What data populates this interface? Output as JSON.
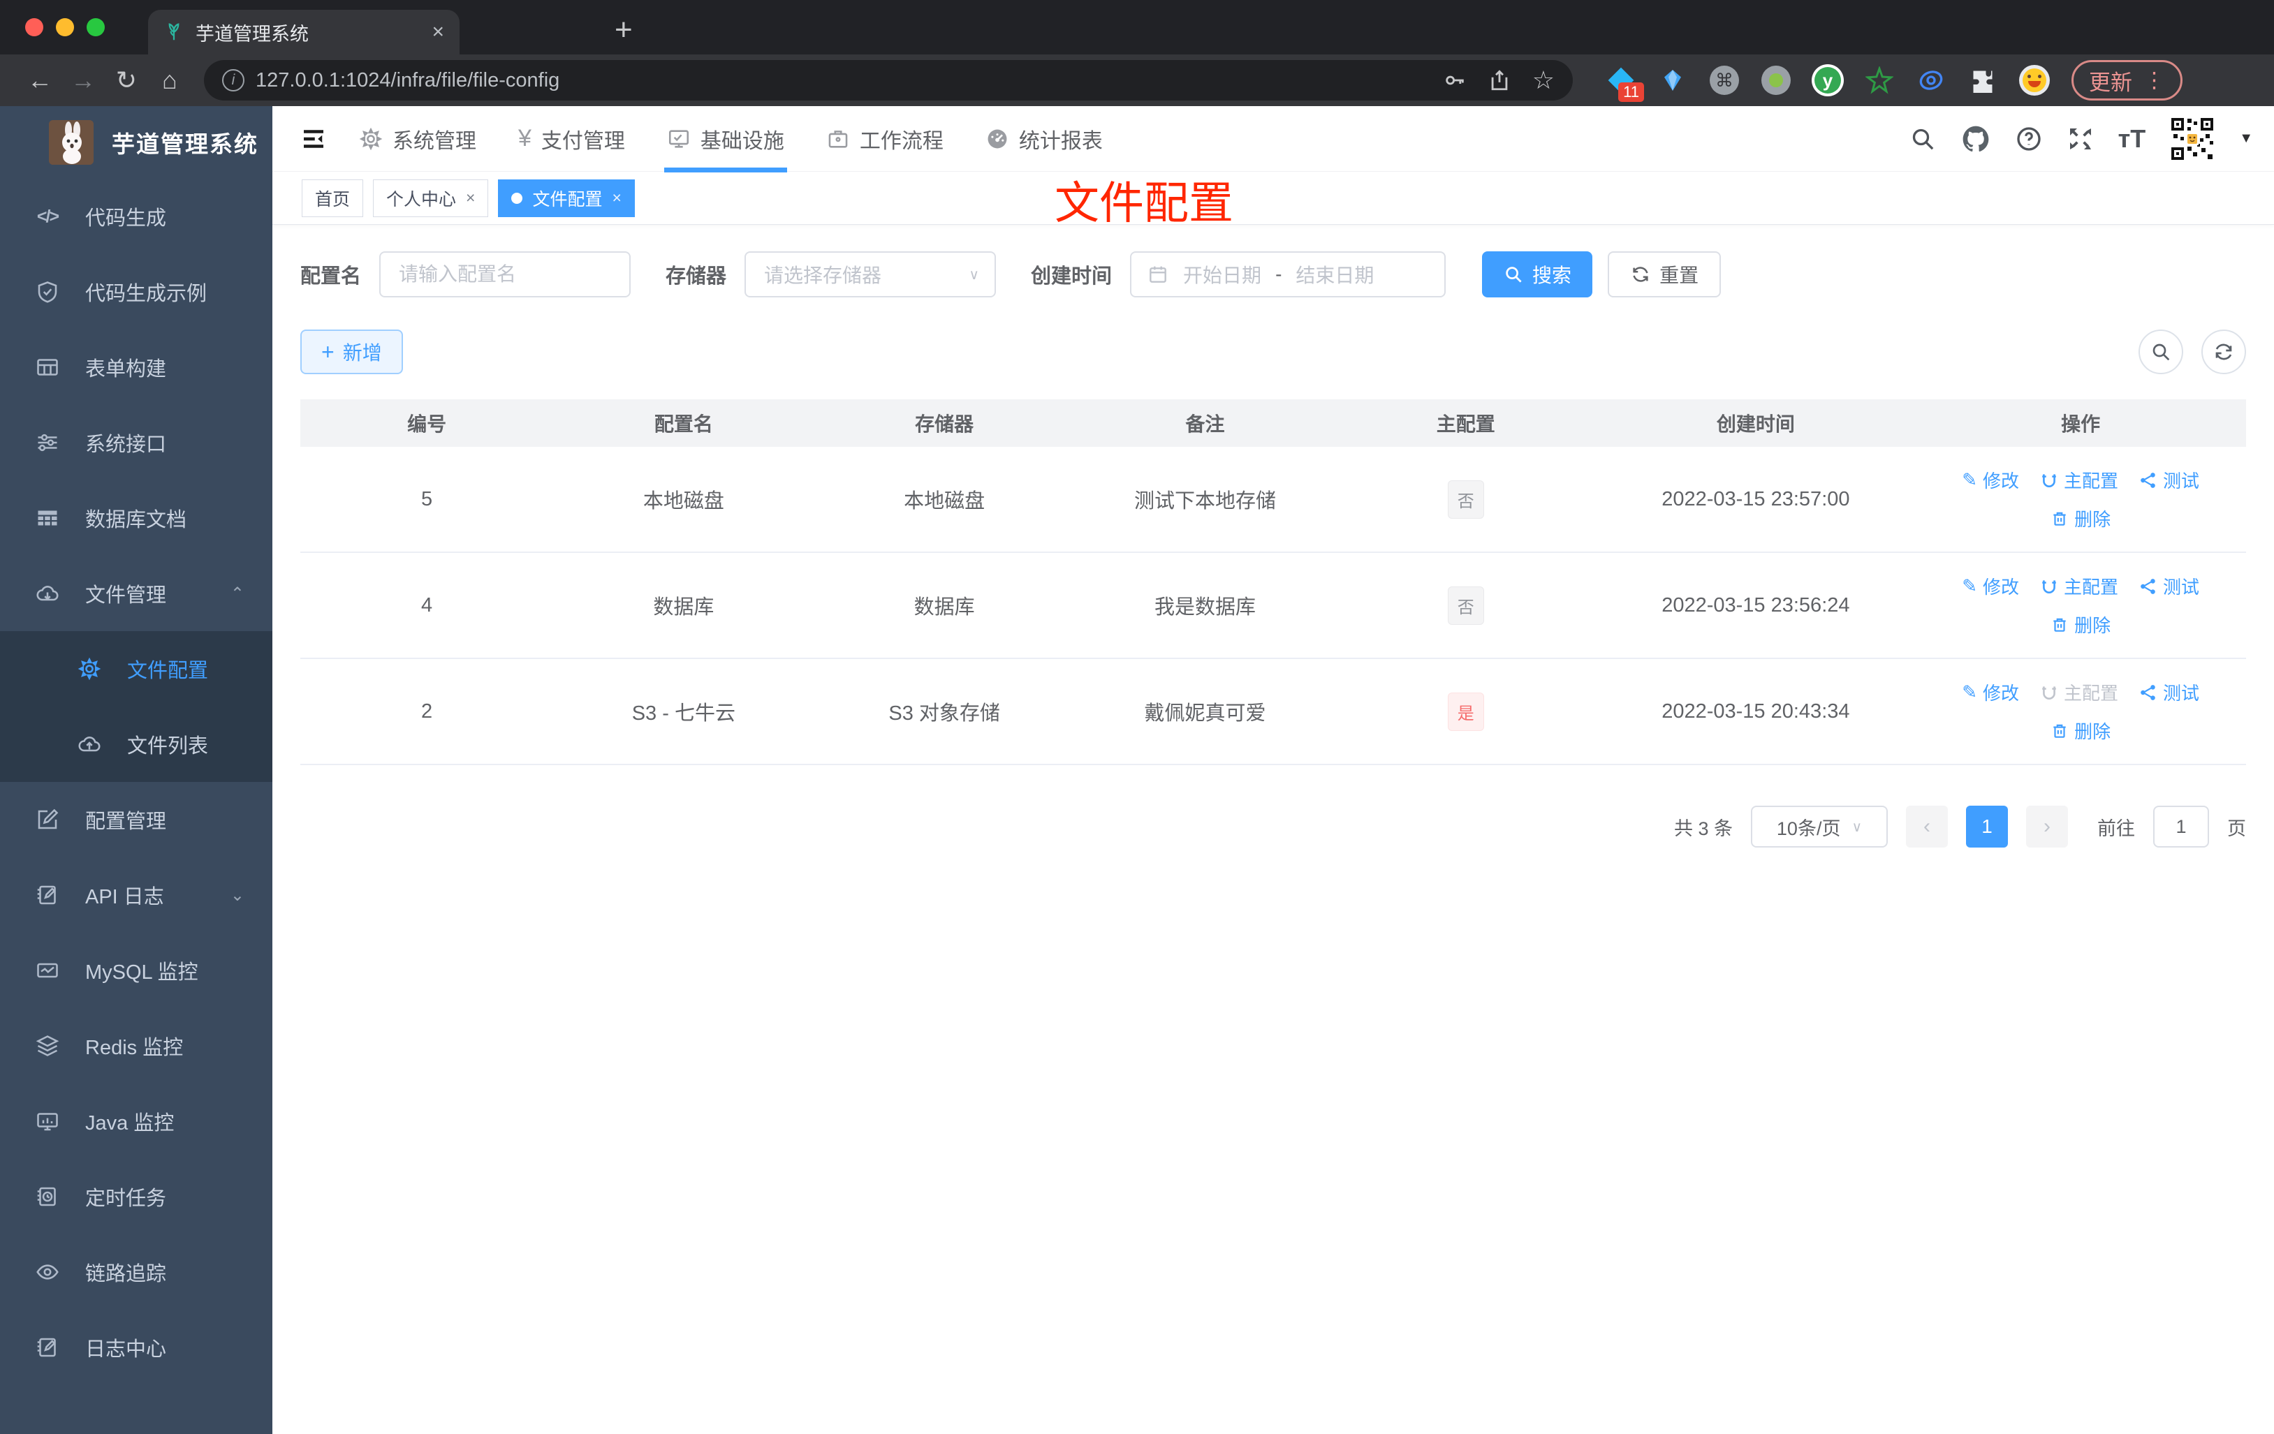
{
  "glyphs": {
    "back": "←",
    "forward": "→",
    "reload": "↻",
    "home": "⌂",
    "close_x": "×",
    "plus": "+",
    "star": "☆",
    "cmd": "⌘",
    "y": "y",
    "dots": "⋮",
    "info": "i",
    "caret_down": "▼",
    "chevron_up": "⌃",
    "chevron_down": "⌄",
    "select_caret": "∨",
    "prev": "‹",
    "next": "›",
    "yen": "¥",
    "code": "</>",
    "question": "?",
    "font_size": "тT",
    "edit_pencil": "✎",
    "dash": "-"
  },
  "browser": {
    "tab_title": "芋道管理系统",
    "url": "127.0.0.1:1024/infra/file/file-config",
    "ext_badge": "11",
    "update_label": "更新"
  },
  "sidebar": {
    "title": "芋道管理系统",
    "items_top": [
      {
        "label": "代码生成",
        "icon": "code-icon"
      },
      {
        "label": "代码生成示例",
        "icon": "shield-check-icon"
      },
      {
        "label": "表单构建",
        "icon": "form-grid-icon"
      },
      {
        "label": "系统接口",
        "icon": "sliders-icon"
      },
      {
        "label": "数据库文档",
        "icon": "table-filled-icon"
      },
      {
        "label": "文件管理",
        "icon": "cloud-download-icon"
      }
    ],
    "sub_items": [
      {
        "label": "文件配置",
        "icon": "gear-icon",
        "active": true
      },
      {
        "label": "文件列表",
        "icon": "cloud-upload-icon",
        "active": false
      }
    ],
    "items_bottom": [
      {
        "label": "配置管理",
        "icon": "edit-square-icon"
      },
      {
        "label": "API 日志",
        "icon": "doc-edit-icon"
      },
      {
        "label": "MySQL 监控",
        "icon": "chart-monitor-icon"
      },
      {
        "label": "Redis 监控",
        "icon": "layers-icon"
      },
      {
        "label": "Java 监控",
        "icon": "monitor-bars-icon"
      },
      {
        "label": "定时任务",
        "icon": "scheduled-task-icon"
      },
      {
        "label": "链路追踪",
        "icon": "eye-icon"
      },
      {
        "label": "日志中心",
        "icon": "doc-edit-icon"
      }
    ]
  },
  "topnav": {
    "items": [
      {
        "label": "系统管理",
        "icon": "gear-icon",
        "active": false
      },
      {
        "label": "支付管理",
        "icon": "yen-icon",
        "active": false
      },
      {
        "label": "基础设施",
        "icon": "monitor-check-icon",
        "active": true
      },
      {
        "label": "工作流程",
        "icon": "briefcase-icon",
        "active": false
      },
      {
        "label": "统计报表",
        "icon": "dashboard-icon",
        "active": false
      }
    ]
  },
  "tags": [
    {
      "label": "首页",
      "closable": false,
      "active": false
    },
    {
      "label": "个人中心",
      "closable": true,
      "active": false
    },
    {
      "label": "文件配置",
      "closable": true,
      "active": true
    }
  ],
  "annotation": {
    "text": "文件配置"
  },
  "filters": {
    "name_label": "配置名",
    "name_placeholder": "请输入配置名",
    "storage_label": "存储器",
    "storage_placeholder": "请选择存储器",
    "time_label": "创建时间",
    "start_placeholder": "开始日期",
    "separator": "-",
    "end_placeholder": "结束日期",
    "search_label": "搜索",
    "reset_label": "重置"
  },
  "toolbar": {
    "add_label": "新增"
  },
  "table": {
    "columns": [
      "编号",
      "配置名",
      "存储器",
      "备注",
      "主配置",
      "创建时间",
      "操作"
    ],
    "actions": {
      "edit": "修改",
      "master": "主配置",
      "test": "测试",
      "delete": "删除"
    },
    "rows": [
      {
        "id": "5",
        "name": "本地磁盘",
        "storage": "本地磁盘",
        "remark": "测试下本地存储",
        "master": "否",
        "master_type": "info",
        "created": "2022-03-15 23:57:00",
        "master_action_disabled": false
      },
      {
        "id": "4",
        "name": "数据库",
        "storage": "数据库",
        "remark": "我是数据库",
        "master": "否",
        "master_type": "info",
        "created": "2022-03-15 23:56:24",
        "master_action_disabled": false
      },
      {
        "id": "2",
        "name": "S3 - 七牛云",
        "storage": "S3 对象存储",
        "remark": "戴佩妮真可爱",
        "master": "是",
        "master_type": "danger",
        "created": "2022-03-15 20:43:34",
        "master_action_disabled": true
      }
    ]
  },
  "pagination": {
    "total": "共 3 条",
    "page_size": "10条/页",
    "current": "1",
    "goto_label": "前往",
    "goto_value": "1",
    "unit": "页"
  },
  "colors": {
    "accent": "#409eff",
    "danger": "#f56c6c",
    "annotation_red": "#ff2600",
    "sidebar_bg": "#3a4a5e",
    "submenu_bg": "#2c3a4a",
    "table_header_bg": "#f2f3f5",
    "tag_info_bg": "#f4f4f5",
    "tag_danger_bg": "#fef0f0",
    "traffic_red": "#ff5f57",
    "traffic_yellow": "#febc2e",
    "traffic_green": "#28c840"
  }
}
